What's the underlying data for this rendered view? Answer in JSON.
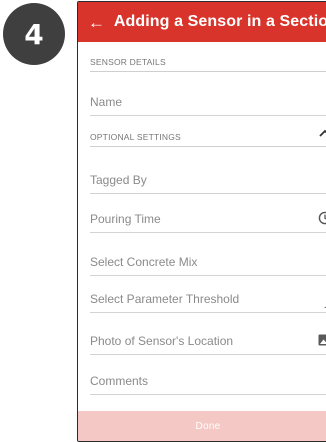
{
  "step": {
    "number": "4"
  },
  "appbar": {
    "back_icon": "←",
    "title": "Adding a Sensor in a Section"
  },
  "sections": {
    "sensor_details": "SENSOR DETAILS",
    "optional_settings": "OPTIONAL SETTINGS"
  },
  "fields": {
    "name": "Name",
    "tagged_by": "Tagged By",
    "pouring_time": "Pouring Time",
    "concrete_mix": "Select Concrete Mix",
    "parameter_threshold": "Select Parameter Threshold",
    "photo_location": "Photo of Sensor's Location",
    "comments": "Comments"
  },
  "icons": {
    "collapse": "chevron-up-icon",
    "pouring_time": "clock-icon",
    "threshold": "dropdown-arrow-icon",
    "photo": "image-icon"
  },
  "footer": {
    "done_label": "Done"
  },
  "colors": {
    "appbar": "#d9342b",
    "done_disabled": "#f4c8c4",
    "badge": "#3f3f3f"
  }
}
